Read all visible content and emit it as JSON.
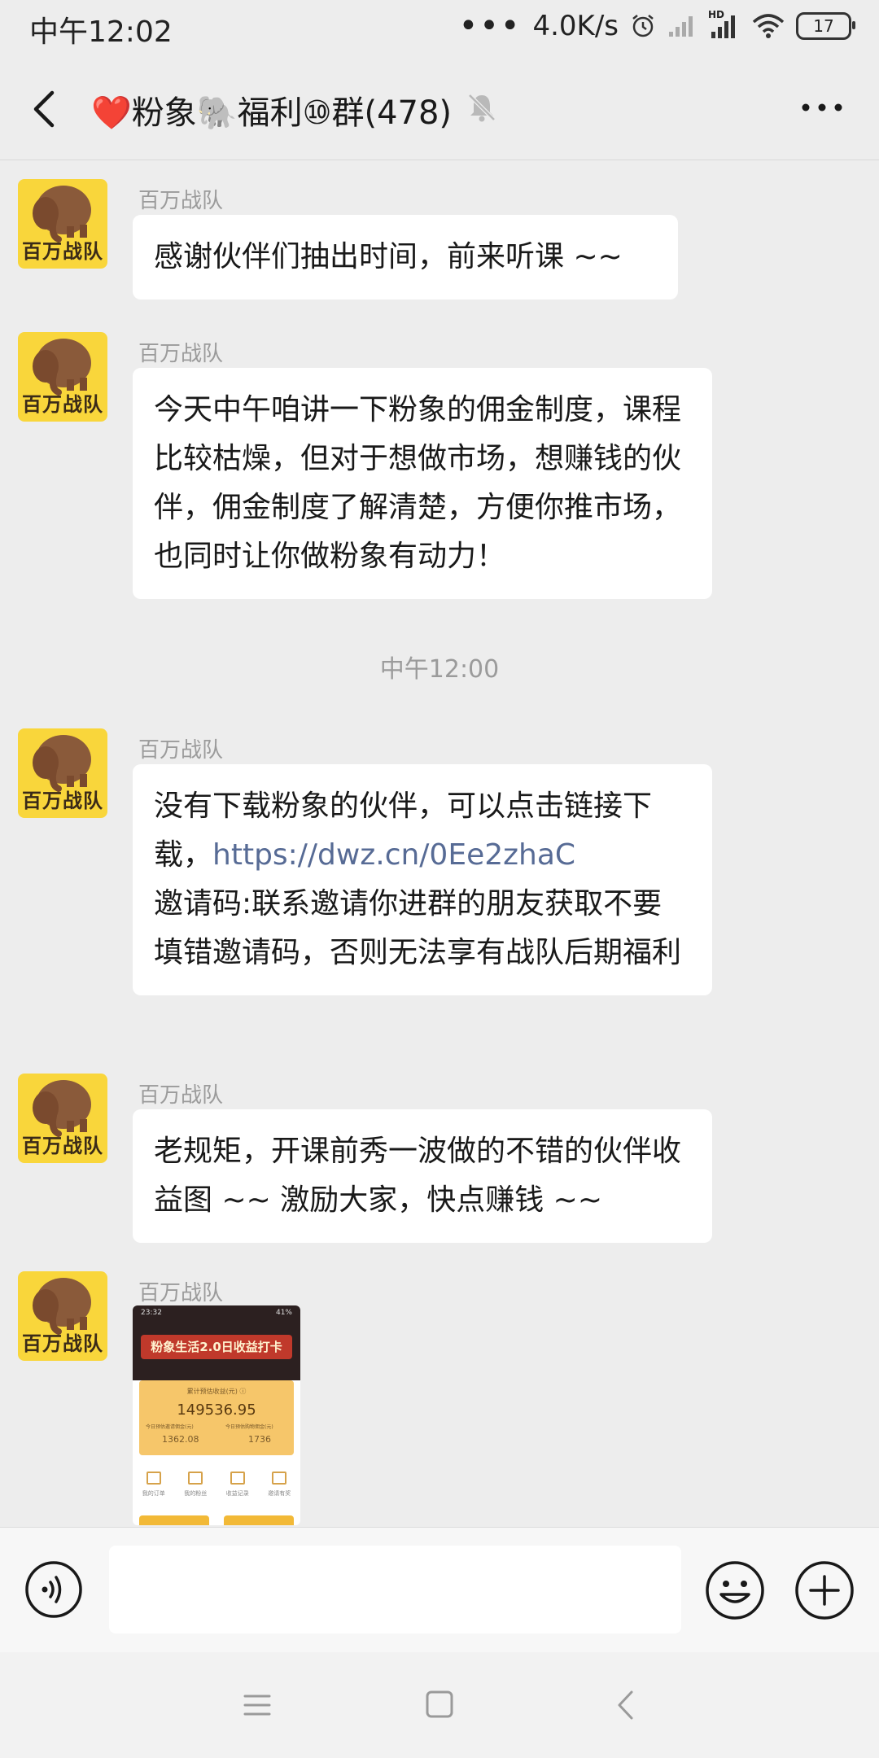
{
  "status_bar": {
    "time": "中午12:02",
    "dots": "•••",
    "network_speed": "4.0K/s",
    "network_type": "HD",
    "battery": "17",
    "icons": [
      "alarm-icon",
      "signal-icon",
      "signal-hd-icon",
      "wifi-icon",
      "battery-icon"
    ]
  },
  "header": {
    "title": "❤️粉象🐘福利⑩群(478)",
    "icons": [
      "back-chevron-icon",
      "mute-bell-icon",
      "more-dots-icon"
    ]
  },
  "messages": [
    {
      "sender": "百万战队",
      "avatar_text": "百万战队",
      "text": "感谢伙伴们抽出时间，前来听课 ~~"
    },
    {
      "sender": "百万战队",
      "avatar_text": "百万战队",
      "text": "今天中午咱讲一下粉象的佣金制度，课程比较枯燥，但对于想做市场，想赚钱的伙伴，佣金制度了解清楚，方便你推市场，也同时让你做粉象有动力！"
    },
    {
      "sender": "百万战队",
      "avatar_text": "百万战队",
      "text_before_link": "没有下载粉象的伙伴，可以点击链接下载，",
      "link": "https://dwz.cn/0Ee2zhaC",
      "text_after_link": "邀请码:联系邀请你进群的朋友获取不要填错邀请码，否则无法享有战队后期福利"
    },
    {
      "sender": "百万战队",
      "avatar_text": "百万战队",
      "text": "老规矩，开课前秀一波做的不错的伙伴收益图 ~~ 激励大家，快点赚钱 ~~"
    },
    {
      "sender": "百万战队",
      "avatar_text": "百万战队",
      "image": {
        "status_time": "23:32",
        "status_battery": "41%",
        "banner": "粉象生活2.0日收益打卡",
        "card_label": "累计预估收益(元) ⓘ",
        "total": "149536.95",
        "left_label": "今日预估邀请佣金(元)",
        "left_value": "1362.08",
        "right_label": "今日预估购物佣金(元)",
        "right_value": "1736",
        "menu": [
          "我的订单",
          "我的粉丝",
          "收益记录",
          "邀请有奖"
        ]
      }
    }
  ],
  "time_separator": "中午12:00",
  "input_bar": {
    "placeholder": "",
    "icons": [
      "voice-icon",
      "emoji-icon",
      "plus-icon"
    ]
  },
  "nav_bar": {
    "icons": [
      "menu-icon",
      "home-square-icon",
      "back-triangle-icon"
    ]
  },
  "colors": {
    "background": "#ededed",
    "bubble": "#ffffff",
    "link": "#576b95",
    "avatar_bg": "#f9d63b",
    "meta_text": "#9b9b9b"
  }
}
